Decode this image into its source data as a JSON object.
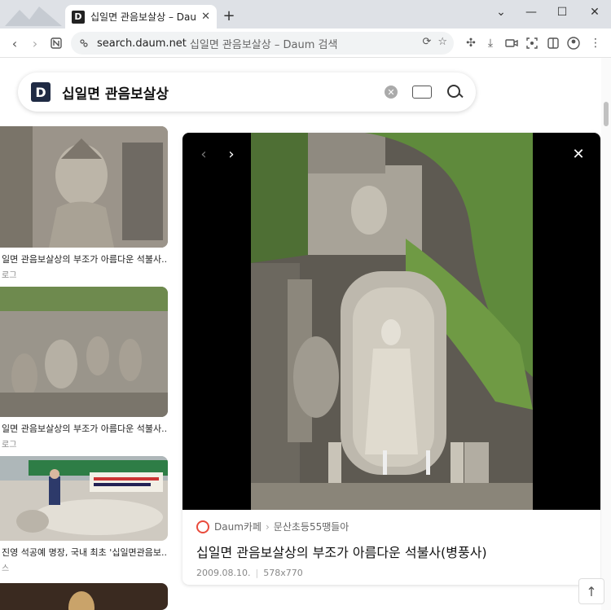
{
  "browser": {
    "tab_title": "십일면 관음보살상 – Daum 검색",
    "tab_favicon": "D",
    "new_tab": "+",
    "url_host": "search.daum.net",
    "url_rest": "십일면 관음보살상 – Daum 검색",
    "window_controls": [
      "minimize",
      "maximize",
      "close"
    ]
  },
  "search": {
    "logo": "D",
    "query": "십일면 관음보살상"
  },
  "results": [
    {
      "caption": "일면 관음보살상의 부조가 아름다운 석불사...",
      "source": "로그"
    },
    {
      "caption": "일면 관음보살상의 부조가 아름다운 석불사...",
      "source": "로그"
    },
    {
      "caption": "진영 석공예 명장, 국내 최초 '십일면관음보...",
      "source": "스"
    }
  ],
  "viewer": {
    "source_name": "Daum카페",
    "source_sep": "›",
    "source_sub": "문산초등55땡들아",
    "title": "십일면 관음보살상의 부조가 아름다운 석불사(병풍사)",
    "date": "2009.08.10.",
    "dimensions": "578x770"
  },
  "colors": {
    "daum_logo": "#1f2a44",
    "cafe_icon": "#e94b3c"
  }
}
